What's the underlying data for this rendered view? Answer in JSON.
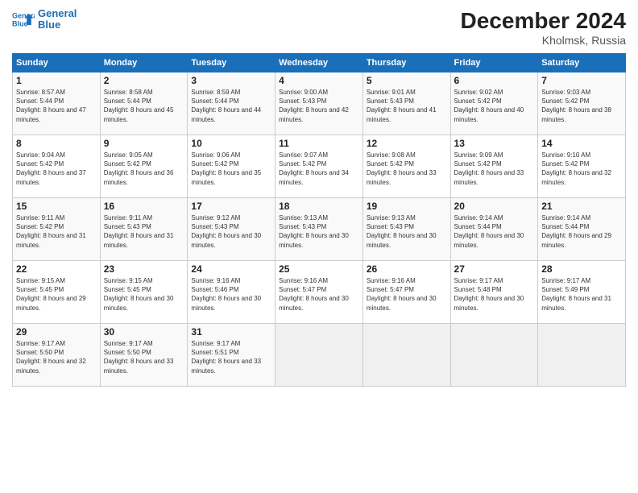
{
  "header": {
    "logo_line1": "General",
    "logo_line2": "Blue",
    "month_year": "December 2024",
    "location": "Kholmsk, Russia"
  },
  "days_of_week": [
    "Sunday",
    "Monday",
    "Tuesday",
    "Wednesday",
    "Thursday",
    "Friday",
    "Saturday"
  ],
  "weeks": [
    [
      {
        "day": "1",
        "sunrise": "8:57 AM",
        "sunset": "5:44 PM",
        "daylight": "8 hours and 47 minutes."
      },
      {
        "day": "2",
        "sunrise": "8:58 AM",
        "sunset": "5:44 PM",
        "daylight": "8 hours and 45 minutes."
      },
      {
        "day": "3",
        "sunrise": "8:59 AM",
        "sunset": "5:44 PM",
        "daylight": "8 hours and 44 minutes."
      },
      {
        "day": "4",
        "sunrise": "9:00 AM",
        "sunset": "5:43 PM",
        "daylight": "8 hours and 42 minutes."
      },
      {
        "day": "5",
        "sunrise": "9:01 AM",
        "sunset": "5:43 PM",
        "daylight": "8 hours and 41 minutes."
      },
      {
        "day": "6",
        "sunrise": "9:02 AM",
        "sunset": "5:42 PM",
        "daylight": "8 hours and 40 minutes."
      },
      {
        "day": "7",
        "sunrise": "9:03 AM",
        "sunset": "5:42 PM",
        "daylight": "8 hours and 38 minutes."
      }
    ],
    [
      {
        "day": "8",
        "sunrise": "9:04 AM",
        "sunset": "5:42 PM",
        "daylight": "8 hours and 37 minutes."
      },
      {
        "day": "9",
        "sunrise": "9:05 AM",
        "sunset": "5:42 PM",
        "daylight": "8 hours and 36 minutes."
      },
      {
        "day": "10",
        "sunrise": "9:06 AM",
        "sunset": "5:42 PM",
        "daylight": "8 hours and 35 minutes."
      },
      {
        "day": "11",
        "sunrise": "9:07 AM",
        "sunset": "5:42 PM",
        "daylight": "8 hours and 34 minutes."
      },
      {
        "day": "12",
        "sunrise": "9:08 AM",
        "sunset": "5:42 PM",
        "daylight": "8 hours and 33 minutes."
      },
      {
        "day": "13",
        "sunrise": "9:09 AM",
        "sunset": "5:42 PM",
        "daylight": "8 hours and 33 minutes."
      },
      {
        "day": "14",
        "sunrise": "9:10 AM",
        "sunset": "5:42 PM",
        "daylight": "8 hours and 32 minutes."
      }
    ],
    [
      {
        "day": "15",
        "sunrise": "9:11 AM",
        "sunset": "5:42 PM",
        "daylight": "8 hours and 31 minutes."
      },
      {
        "day": "16",
        "sunrise": "9:11 AM",
        "sunset": "5:43 PM",
        "daylight": "8 hours and 31 minutes."
      },
      {
        "day": "17",
        "sunrise": "9:12 AM",
        "sunset": "5:43 PM",
        "daylight": "8 hours and 30 minutes."
      },
      {
        "day": "18",
        "sunrise": "9:13 AM",
        "sunset": "5:43 PM",
        "daylight": "8 hours and 30 minutes."
      },
      {
        "day": "19",
        "sunrise": "9:13 AM",
        "sunset": "5:43 PM",
        "daylight": "8 hours and 30 minutes."
      },
      {
        "day": "20",
        "sunrise": "9:14 AM",
        "sunset": "5:44 PM",
        "daylight": "8 hours and 30 minutes."
      },
      {
        "day": "21",
        "sunrise": "9:14 AM",
        "sunset": "5:44 PM",
        "daylight": "8 hours and 29 minutes."
      }
    ],
    [
      {
        "day": "22",
        "sunrise": "9:15 AM",
        "sunset": "5:45 PM",
        "daylight": "8 hours and 29 minutes."
      },
      {
        "day": "23",
        "sunrise": "9:15 AM",
        "sunset": "5:45 PM",
        "daylight": "8 hours and 30 minutes."
      },
      {
        "day": "24",
        "sunrise": "9:16 AM",
        "sunset": "5:46 PM",
        "daylight": "8 hours and 30 minutes."
      },
      {
        "day": "25",
        "sunrise": "9:16 AM",
        "sunset": "5:47 PM",
        "daylight": "8 hours and 30 minutes."
      },
      {
        "day": "26",
        "sunrise": "9:16 AM",
        "sunset": "5:47 PM",
        "daylight": "8 hours and 30 minutes."
      },
      {
        "day": "27",
        "sunrise": "9:17 AM",
        "sunset": "5:48 PM",
        "daylight": "8 hours and 30 minutes."
      },
      {
        "day": "28",
        "sunrise": "9:17 AM",
        "sunset": "5:49 PM",
        "daylight": "8 hours and 31 minutes."
      }
    ],
    [
      {
        "day": "29",
        "sunrise": "9:17 AM",
        "sunset": "5:50 PM",
        "daylight": "8 hours and 32 minutes."
      },
      {
        "day": "30",
        "sunrise": "9:17 AM",
        "sunset": "5:50 PM",
        "daylight": "8 hours and 33 minutes."
      },
      {
        "day": "31",
        "sunrise": "9:17 AM",
        "sunset": "5:51 PM",
        "daylight": "8 hours and 33 minutes."
      },
      null,
      null,
      null,
      null
    ]
  ]
}
